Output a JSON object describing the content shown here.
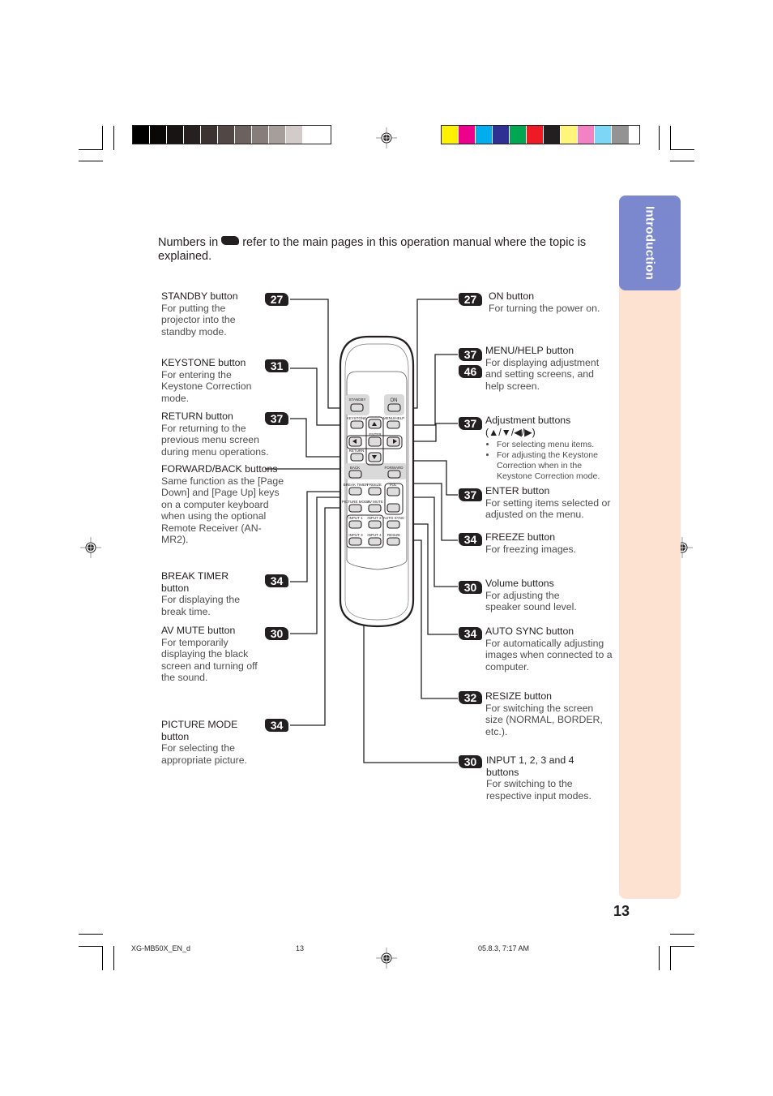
{
  "colors": {
    "gray_bar": [
      "#000000",
      "#0a0807",
      "#171413",
      "#262120",
      "#3b3331",
      "#514845",
      "#6b615e",
      "#877d7a",
      "#a69e9b",
      "#d3cbca",
      "#ffffff"
    ],
    "color_bar": [
      "#fff200",
      "#ec008c",
      "#00aeef",
      "#2e3192",
      "#00a651",
      "#ed1c24",
      "#231f20",
      "#fff57a",
      "#f282c3",
      "#7ed6f7",
      "#939393"
    ],
    "side_tab": "#7b88cd",
    "side_strip": "#fde2d2",
    "badge": "#231f20"
  },
  "intro_note": {
    "before": "Numbers in",
    "after": "refer to the main pages in this operation manual where the topic is explained."
  },
  "side_tab_label": "Introduction",
  "page_number": "13",
  "footer": {
    "file": "XG-MB50X_EN_d",
    "page": "13",
    "date": "05.8.3, 7:17 AM"
  },
  "remote": {
    "labels": {
      "standby": "STANDBY",
      "on": "ON",
      "keystone": "KEYSTONE",
      "menu_help": "MENU/HELP",
      "enter": "ENTER",
      "return": "RETURN",
      "back": "BACK",
      "forward": "FORWARD",
      "break_timer": "BREAK TIMER",
      "freeze": "FREEZE",
      "vol": "VOL",
      "picture_mode": "PICTURE MODE",
      "av_mute": "AV MUTE",
      "input1": "INPUT 1",
      "input2": "INPUT 2",
      "auto_sync": "AUTO SYNC",
      "input3": "INPUT 3",
      "input4": "INPUT 4",
      "resize": "RESIZE"
    }
  },
  "left_items": [
    {
      "page": "27",
      "title": "STANDBY button",
      "body": "For putting the projector into the standby mode."
    },
    {
      "page": "31",
      "title": "KEYSTONE button",
      "body": "For entering the Keystone Correction mode."
    },
    {
      "page": "37",
      "title": "RETURN button",
      "body": "For returning to the previous menu screen during menu operations."
    },
    {
      "page": "",
      "title": "FORWARD/BACK buttons",
      "body": "Same function as the [Page Down] and [Page Up] keys on a computer keyboard when using the optional Remote Receiver (AN-MR2)."
    },
    {
      "page": "34",
      "title": "BREAK TIMER button",
      "body": "For displaying the break time."
    },
    {
      "page": "30",
      "title": "AV MUTE button",
      "body": "For temporarily displaying the black screen and turning off the sound."
    },
    {
      "page": "34",
      "title": "PICTURE MODE button",
      "body": "For selecting the appropriate picture."
    }
  ],
  "right_items": [
    {
      "pages": [
        "27"
      ],
      "title": "ON button",
      "body": "For turning the power on."
    },
    {
      "pages": [
        "37",
        "46"
      ],
      "title": "MENU/HELP button",
      "body": "For displaying adjustment and setting screens, and help screen."
    },
    {
      "pages": [
        "37"
      ],
      "title": "Adjustment buttons (▲/▼/◀/▶)",
      "body": "",
      "bullets": [
        "For selecting menu items.",
        "For adjusting the Keystone Correction when in the Keystone Correction mode."
      ]
    },
    {
      "pages": [
        "37"
      ],
      "title": "ENTER button",
      "body": "For setting items selected or adjusted on the menu."
    },
    {
      "pages": [
        "34"
      ],
      "title": "FREEZE button",
      "body": "For freezing images."
    },
    {
      "pages": [
        "30"
      ],
      "title": "Volume buttons",
      "body": "For adjusting the speaker sound level."
    },
    {
      "pages": [
        "34"
      ],
      "title": "AUTO SYNC button",
      "body": "For automatically adjusting images when connected to a computer."
    },
    {
      "pages": [
        "32"
      ],
      "title": "RESIZE button",
      "body": "For switching the screen size (NORMAL, BORDER, etc.)."
    },
    {
      "pages": [
        "30"
      ],
      "title": "INPUT 1, 2, 3 and 4 buttons",
      "body": "For switching to the respective input modes."
    }
  ]
}
